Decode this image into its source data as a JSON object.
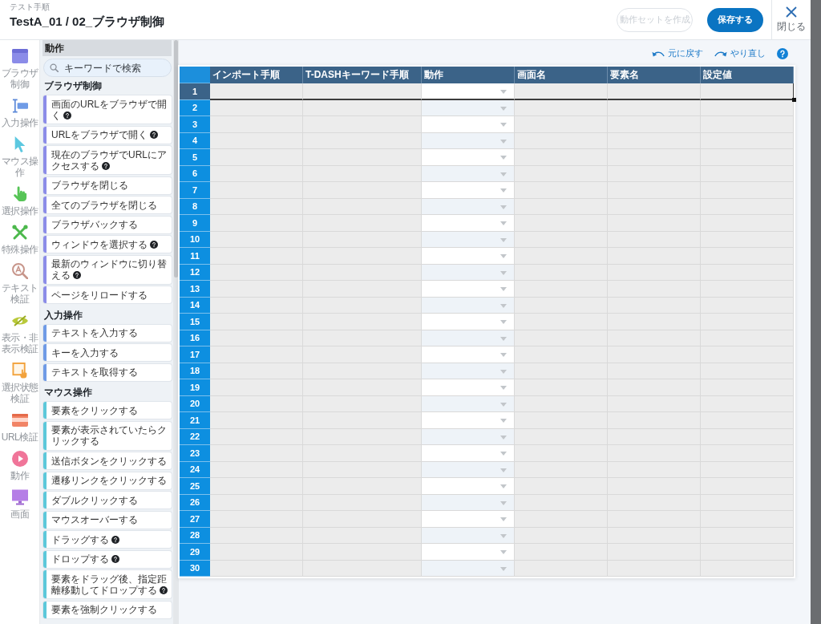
{
  "header": {
    "breadcrumb": "テスト手順",
    "title": "TestA_01 / 02_ブラウザ制御"
  },
  "header_buttons": [
    {
      "label": "動作セットを作成",
      "kind": "outline",
      "disabled": true
    },
    {
      "label": "保存する",
      "kind": "primary",
      "disabled": false
    }
  ],
  "close_button": {
    "label": "閉じる"
  },
  "category_nav": [
    {
      "label": "ブラウザ制御",
      "kind": "browser"
    },
    {
      "label": "入力操作",
      "kind": "input"
    },
    {
      "label": "マウス操作",
      "kind": "mouse"
    },
    {
      "label": "選択操作",
      "kind": "select"
    },
    {
      "label": "特殊操作",
      "kind": "special"
    },
    {
      "label": "テキスト検証",
      "kind": "text"
    },
    {
      "label": "表示・非表示検証",
      "kind": "visibility"
    },
    {
      "label": "選択状態検証",
      "kind": "state"
    },
    {
      "label": "URL検証",
      "kind": "url"
    },
    {
      "label": "動作",
      "kind": "action"
    },
    {
      "label": "画面",
      "kind": "screen"
    }
  ],
  "action_panel": {
    "title": "動作",
    "search": {
      "placeholder": "キーワードで検索"
    },
    "sections": [
      {
        "title": "ブラウザ制御",
        "color": "#8b8ce8",
        "items": [
          {
            "label": "画面のURLをブラウザで開く",
            "help": true
          },
          {
            "label": "URLをブラウザで開く",
            "help": true
          },
          {
            "label": "現在のブラウザでURLにアクセスする",
            "help": true
          },
          {
            "label": "ブラウザを閉じる",
            "help": false
          },
          {
            "label": "全てのブラウザを閉じる",
            "help": false
          },
          {
            "label": "ブラウザバックする",
            "help": false
          },
          {
            "label": "ウィンドウを選択する",
            "help": true
          },
          {
            "label": "最新のウィンドウに切り替える",
            "help": true
          },
          {
            "label": "ページをリロードする",
            "help": false
          }
        ]
      },
      {
        "title": "入力操作",
        "color": "#6f9be6",
        "items": [
          {
            "label": "テキストを入力する",
            "help": false
          },
          {
            "label": "キーを入力する",
            "help": false
          },
          {
            "label": "テキストを取得する",
            "help": false
          }
        ]
      },
      {
        "title": "マウス操作",
        "color": "#5cc8da",
        "items": [
          {
            "label": "要素をクリックする",
            "help": false
          },
          {
            "label": "要素が表示されていたらクリックする",
            "help": false
          },
          {
            "label": "送信ボタンをクリックする",
            "help": false
          },
          {
            "label": "遷移リンクをクリックする",
            "help": false
          },
          {
            "label": "ダブルクリックする",
            "help": false
          },
          {
            "label": "マウスオーバーする",
            "help": false
          },
          {
            "label": "ドラッグする",
            "help": true
          },
          {
            "label": "ドロップする",
            "help": true
          },
          {
            "label": "要素をドラッグ後、指定距離移動してドロップする",
            "help": true
          },
          {
            "label": "要素を強制クリックする",
            "help": false
          }
        ]
      }
    ]
  },
  "toolbar": [
    {
      "label": "元に戻す",
      "kind": "undo"
    },
    {
      "label": "やり直し",
      "kind": "redo"
    }
  ],
  "table": {
    "columns": [
      {
        "label": "インポート手順",
        "kind": "text"
      },
      {
        "label": "T-DASHキーワード手順",
        "kind": "text"
      },
      {
        "label": "動作",
        "kind": "select"
      },
      {
        "label": "画面名",
        "kind": "text"
      },
      {
        "label": "要素名",
        "kind": "text"
      },
      {
        "label": "設定値",
        "kind": "text"
      }
    ],
    "rows": [
      {
        "number": "1",
        "selected": true
      },
      {
        "number": "2",
        "selected": false
      },
      {
        "number": "3",
        "selected": false
      },
      {
        "number": "4",
        "selected": false
      },
      {
        "number": "5",
        "selected": false
      },
      {
        "number": "6",
        "selected": false
      },
      {
        "number": "7",
        "selected": false
      },
      {
        "number": "8",
        "selected": false
      },
      {
        "number": "9",
        "selected": false
      },
      {
        "number": "10",
        "selected": false
      },
      {
        "number": "11",
        "selected": false
      },
      {
        "number": "12",
        "selected": false
      },
      {
        "number": "13",
        "selected": false
      },
      {
        "number": "14",
        "selected": false
      },
      {
        "number": "15",
        "selected": false
      },
      {
        "number": "16",
        "selected": false
      },
      {
        "number": "17",
        "selected": false
      },
      {
        "number": "18",
        "selected": false
      },
      {
        "number": "19",
        "selected": false
      },
      {
        "number": "20",
        "selected": false
      },
      {
        "number": "21",
        "selected": false
      },
      {
        "number": "22",
        "selected": false
      },
      {
        "number": "23",
        "selected": false
      },
      {
        "number": "24",
        "selected": false
      },
      {
        "number": "25",
        "selected": false
      },
      {
        "number": "26",
        "selected": false
      },
      {
        "number": "27",
        "selected": false
      },
      {
        "number": "28",
        "selected": false
      },
      {
        "number": "29",
        "selected": false
      },
      {
        "number": "30",
        "selected": false
      }
    ]
  }
}
